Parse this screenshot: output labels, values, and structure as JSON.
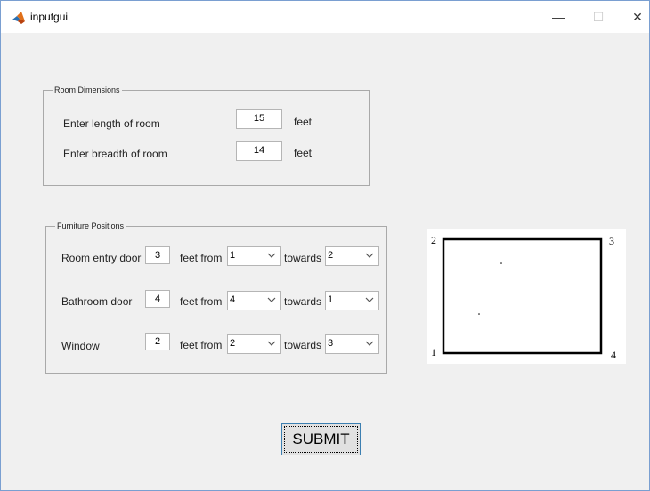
{
  "window": {
    "title": "inputgui",
    "controls": {
      "minimize": "—",
      "maximize": "☐",
      "close": "✕"
    }
  },
  "room_dimensions": {
    "title": "Room Dimensions",
    "length_label": "Enter length of room",
    "length_value": "15",
    "breadth_label": "Enter breadth of room",
    "breadth_value": "14",
    "unit": "feet"
  },
  "furniture_positions": {
    "title": "Furniture Positions",
    "feet_from_label": "feet from",
    "towards_label": "towards",
    "rows": [
      {
        "label": "Room entry door",
        "distance": "3",
        "from": "1",
        "towards": "2"
      },
      {
        "label": "Bathroom door",
        "distance": "4",
        "from": "4",
        "towards": "1"
      },
      {
        "label": "Window",
        "distance": "2",
        "from": "2",
        "towards": "3"
      }
    ]
  },
  "diagram": {
    "corners": {
      "top_left": "2",
      "top_right": "3",
      "bottom_left": "1",
      "bottom_right": "4"
    }
  },
  "submit_label": "SUBMIT",
  "colors": {
    "window_bg": "#f0f0f0",
    "border_accent": "#7a9fd1",
    "button_border": "#3c7fb1"
  }
}
